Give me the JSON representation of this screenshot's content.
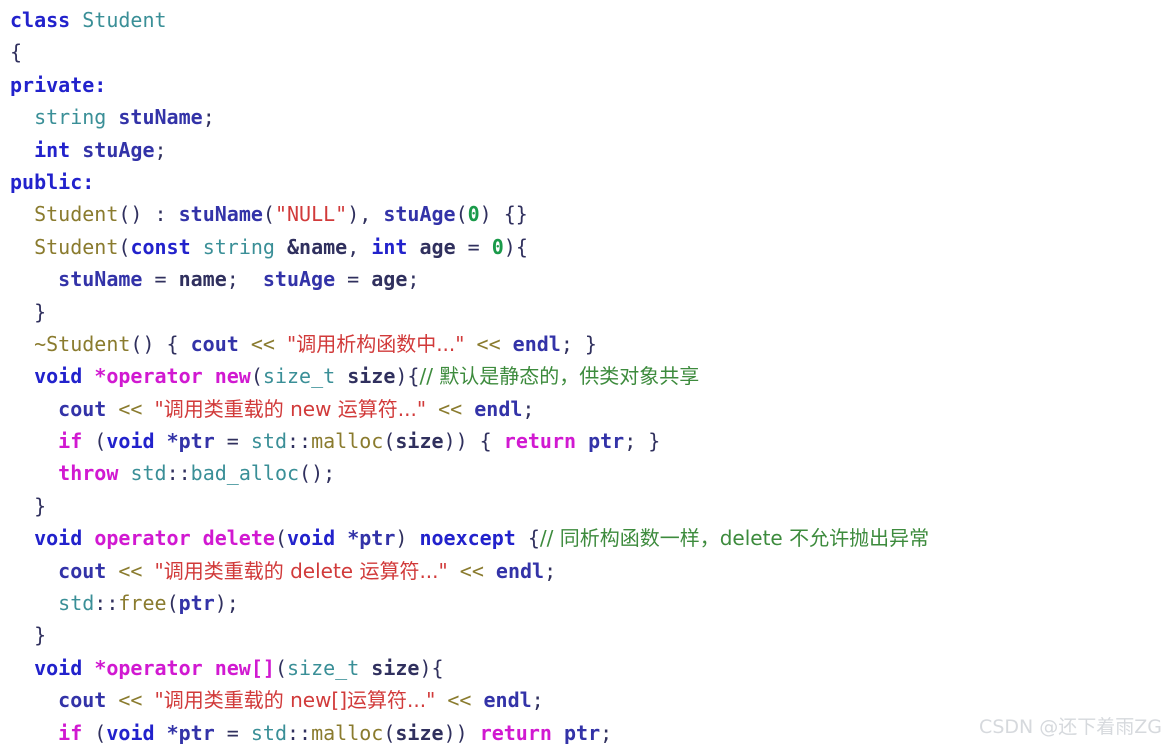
{
  "editor": {
    "language": "cpp",
    "background_color": "#ffffff",
    "default_text_color": "#30305e",
    "font_size_px": 20,
    "line_height_px": 32.4
  },
  "palette": {
    "keyword": "#2222cc",
    "type": "#3a8f97",
    "variable": "#3333a8",
    "function": "#8a7b2e",
    "operator": "#8a7b2e",
    "magenta_keyword": "#d119d1",
    "string": "#d13a3a",
    "number": "#1a9a4a",
    "comment": "#3d8b3d",
    "punctuation": "#30305e",
    "watermark": "#d6d9dd"
  },
  "code": {
    "lines": [
      "class Student",
      "{",
      "private:",
      "  string stuName;",
      "  int stuAge;",
      "public:",
      "  Student() : stuName(\"NULL\"), stuAge(0) {}",
      "  Student(const string &name, int age = 0){",
      "    stuName = name;  stuAge = age;",
      "  }",
      "  ~Student() { cout << \"调用析构函数中...\" << endl; }",
      "  void *operator new(size_t size){// 默认是静态的，供类对象共享",
      "    cout << \"调用类重载的 new 运算符...\" << endl;",
      "    if (void *ptr = std::malloc(size)) { return ptr; }",
      "    throw std::bad_alloc();",
      "  }",
      "  void operator delete(void *ptr) noexcept {// 同析构函数一样，delete 不允许抛出异常",
      "    cout << \"调用类重载的 delete 运算符...\" << endl;",
      "    std::free(ptr);",
      "  }",
      "  void *operator new[](size_t size){",
      "    cout << \"调用类重载的 new[]运算符...\" << endl;",
      "    if (void *ptr = std::malloc(size)) return ptr;"
    ],
    "tokens": {
      "l1": {
        "kw_class": "class",
        "cls_student": "Student"
      },
      "l2": {
        "brace": "{"
      },
      "l3": {
        "kw_private": "private:"
      },
      "l4": {
        "type_string": "string",
        "var_stuname": "stuName",
        "semi": ";"
      },
      "l5": {
        "kw_int": "int",
        "var_stuage": "stuAge",
        "semi": ";"
      },
      "l6": {
        "kw_public": "public:"
      },
      "l7": {
        "fn_student": "Student",
        "parens": "()",
        "colon": " : ",
        "var_stuname": "stuName",
        "str_null": "\"NULL\"",
        "var_stuage": "stuAge",
        "num_zero": "0",
        "empty_body": "{}"
      },
      "l8": {
        "fn_student": "Student",
        "kw_const": "const",
        "type_string": "string",
        "ident_name": "&name",
        "kw_int": "int",
        "ident_age": "age",
        "eq": "=",
        "num_zero": "0",
        "open": "){"
      },
      "l9": {
        "var_stuname": "stuName",
        "ident_name": "name",
        "var_stuage": "stuAge",
        "ident_age": "age"
      },
      "l10": {
        "brace": "}"
      },
      "l11": {
        "fn_dtor": "~Student",
        "parens": "()",
        "var_cout": "cout",
        "op_shift": "<<",
        "str_msg": "\"调用析构函数中...\"",
        "var_endl": "endl"
      },
      "l12": {
        "kw_void": "void",
        "magenta_opnew": "*operator new",
        "type_sizet": "size_t",
        "ident_size": "size",
        "comment": "// 默认是静态的，供类对象共享"
      },
      "l13": {
        "var_cout": "cout",
        "op_shift": "<<",
        "str_msg": "\"调用类重载的 new 运算符...\"",
        "var_endl": "endl"
      },
      "l14": {
        "kw_if": "if",
        "kw_void": "void",
        "var_ptr": "*ptr",
        "type_std": "std",
        "fn_malloc": "malloc",
        "ident_size": "size",
        "kw_return": "return",
        "var_ptr2": "ptr"
      },
      "l15": {
        "kw_throw": "throw",
        "type_std": "std",
        "type_badalloc": "bad_alloc"
      },
      "l16": {
        "brace": "}"
      },
      "l17": {
        "kw_void": "void",
        "magenta_opdelete": "operator delete",
        "kw_void2": "void",
        "var_ptr": "*ptr",
        "kw_noexcept": "noexcept",
        "comment": "// 同析构函数一样，delete 不允许抛出异常"
      },
      "l18": {
        "var_cout": "cout",
        "op_shift": "<<",
        "str_msg": "\"调用类重载的 delete 运算符...\"",
        "var_endl": "endl"
      },
      "l19": {
        "type_std": "std",
        "fn_free": "free",
        "var_ptr": "ptr"
      },
      "l20": {
        "brace": "}"
      },
      "l21": {
        "kw_void": "void",
        "magenta_opnewarr": "*operator new[]",
        "type_sizet": "size_t",
        "ident_size": "size",
        "open": "){"
      },
      "l22": {
        "var_cout": "cout",
        "op_shift": "<<",
        "str_msg": "\"调用类重载的 new[]运算符...\"",
        "var_endl": "endl"
      },
      "l23": {
        "kw_if": "if",
        "kw_void": "void",
        "var_ptr": "*ptr",
        "type_std": "std",
        "fn_malloc": "malloc",
        "ident_size": "size",
        "kw_return": "return",
        "var_ptr2": "ptr"
      }
    }
  },
  "watermark": {
    "text": "CSDN @还下着雨ZG"
  }
}
